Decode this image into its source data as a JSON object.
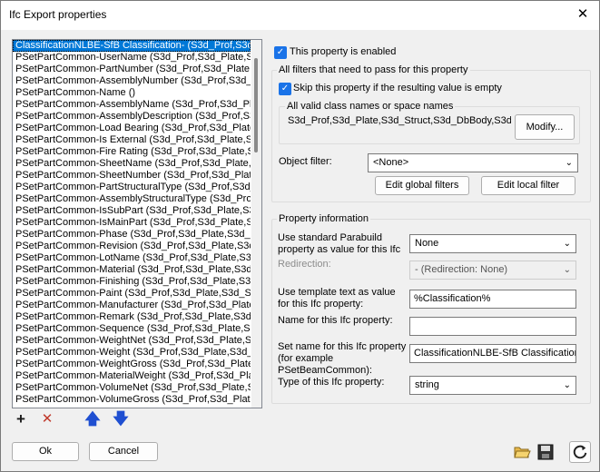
{
  "window": {
    "title": "Ifc Export properties",
    "close_glyph": "✕"
  },
  "list": {
    "items": [
      "ClassificationNLBE-SfB Classification- (S3d_Prof,S3d_",
      "PSetPartCommon-UserName (S3d_Prof,S3d_Plate,S3",
      "PSetPartCommon-PartNumber (S3d_Prof,S3d_Plate,S",
      "PSetPartCommon-AssemblyNumber (S3d_Prof,S3d_Pl",
      "PSetPartCommon-Name ()",
      "PSetPartCommon-AssemblyName (S3d_Prof,S3d_Plat",
      "PSetPartCommon-AssemblyDescription (S3d_Prof,S3d",
      "PSetPartCommon-Load Bearing (S3d_Prof,S3d_Plate,",
      "PSetPartCommon-Is External (S3d_Prof,S3d_Plate,S3",
      "PSetPartCommon-Fire Rating (S3d_Prof,S3d_Plate,S3",
      "PSetPartCommon-SheetName (S3d_Prof,S3d_Plate,S3",
      "PSetPartCommon-SheetNumber (S3d_Prof,S3d_Plate",
      "PSetPartCommon-PartStructuralType (S3d_Prof,S3d_P",
      "PSetPartCommon-AssemblyStructuralType (S3d_Prof",
      "PSetPartCommon-IsSubPart (S3d_Prof,S3d_Plate,S3",
      "PSetPartCommon-IsMainPart (S3d_Prof,S3d_Plate,S3",
      "PSetPartCommon-Phase (S3d_Prof,S3d_Plate,S3d_S",
      "PSetPartCommon-Revision (S3d_Prof,S3d_Plate,S3d_",
      "PSetPartCommon-LotName (S3d_Prof,S3d_Plate,S3d",
      "PSetPartCommon-Material (S3d_Prof,S3d_Plate,S3d_",
      "PSetPartCommon-Finishing (S3d_Prof,S3d_Plate,S3d",
      "PSetPartCommon-Paint (S3d_Prof,S3d_Plate,S3d_Str",
      "PSetPartCommon-Manufacturer (S3d_Prof,S3d_Plate",
      "PSetPartCommon-Remark (S3d_Prof,S3d_Plate,S3d_",
      "PSetPartCommon-Sequence (S3d_Prof,S3d_Plate,S3",
      "PSetPartCommon-WeightNet (S3d_Prof,S3d_Plate,S3",
      "PSetPartCommon-Weight (S3d_Prof,S3d_Plate,S3d_S",
      "PSetPartCommon-WeightGross (S3d_Prof,S3d_Plate,S",
      "PSetPartCommon-MaterialWeight (S3d_Prof,S3d_Pla",
      "PSetPartCommon-VolumeNet (S3d_Prof,S3d_Plate,S3",
      "PSetPartCommon-VolumeGross (S3d_Prof,S3d_Plate,"
    ],
    "selected_index": 0
  },
  "list_tools": {
    "add_glyph": "+",
    "delete_glyph": "✕",
    "up_glyph": "🡅",
    "down_glyph": "🡇"
  },
  "enabled": {
    "label": "This property is enabled",
    "checked": true
  },
  "filters": {
    "group_label": "All filters that need to pass for this property",
    "skip_label": "Skip this property if the resulting value is empty",
    "classes_group_label": "All valid class names or space names",
    "classes_value": "S3d_Prof,S3d_Plate,S3d_Struct,S3d_DbBody,S3d_",
    "modify_button": "Modify...",
    "object_filter_label": "Object filter:",
    "object_filter_value": "<None>",
    "edit_global_button": "Edit global filters",
    "edit_local_button": "Edit local filter"
  },
  "info": {
    "group_label": "Property information",
    "use_standard_label_1": "Use standard Parabuild",
    "use_standard_label_2": "property as value for this Ifc",
    "use_standard_value": "None",
    "redirection_label": "Redirection:",
    "redirection_value": "-  (Redirection: None)",
    "template_label_1": "Use template text as value",
    "template_label_2": "for this Ifc property:",
    "template_value": "%Classification%",
    "name_label": "Name for this Ifc property:",
    "name_value": "",
    "setname_label_1": "Set name for this Ifc property",
    "setname_label_2": "(for example",
    "setname_label_3": "PSetBeamCommon):",
    "setname_value": "ClassificationNLBE-SfB Classification",
    "type_label": "Type of this Ifc property:",
    "type_value": "string"
  },
  "footer": {
    "ok": "Ok",
    "cancel": "Cancel"
  },
  "colors": {
    "accent": "#0078d7",
    "checkbox": "#1a73e8",
    "add": "#1a1a1a",
    "delete": "#c0392b",
    "arrows": "#1f4fd1"
  }
}
